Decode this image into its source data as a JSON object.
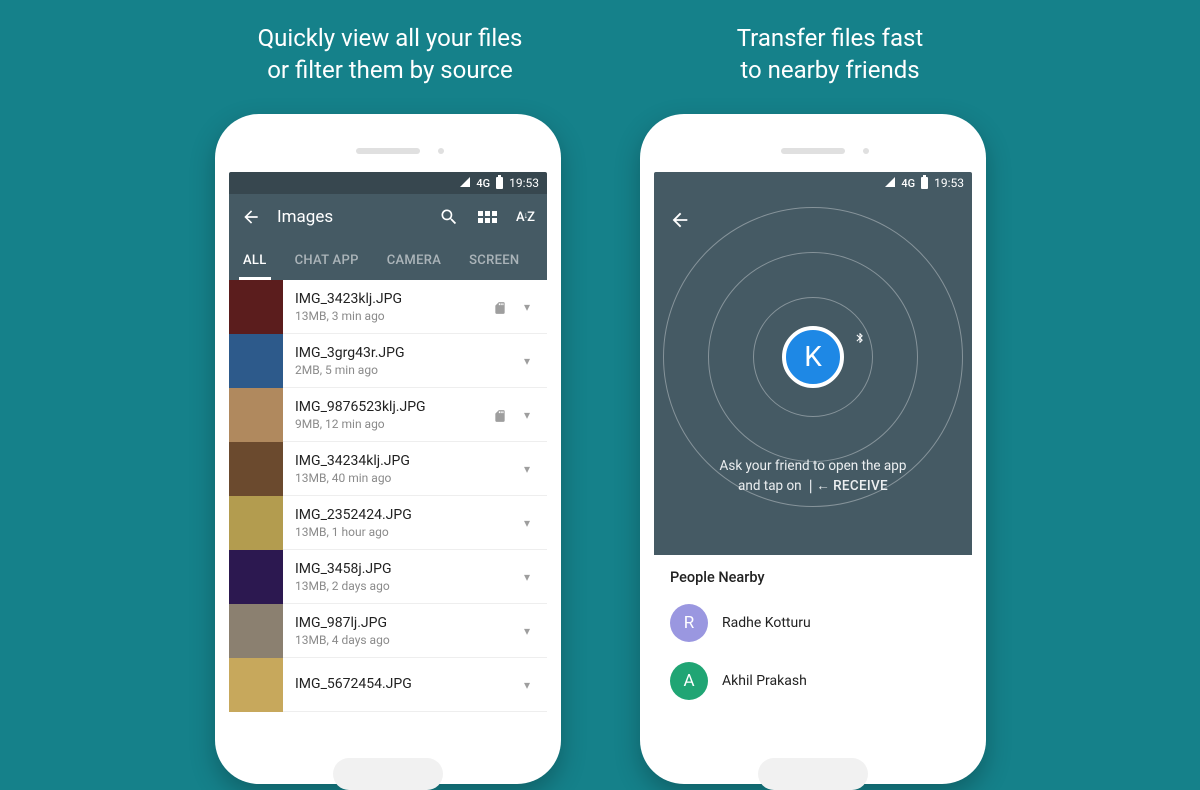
{
  "captions": {
    "left_line1": "Quickly view all your files",
    "left_line2": "or filter them by source",
    "right_line1": "Transfer files fast",
    "right_line2": "to nearby friends"
  },
  "status": {
    "network": "4G",
    "time": "19:53"
  },
  "left": {
    "title": "Images",
    "tabs": [
      "ALL",
      "CHAT APP",
      "CAMERA",
      "SCREEN"
    ],
    "files": [
      {
        "name": "IMG_3423klj.JPG",
        "sub": "13MB, 3 min ago",
        "sd": true,
        "thumb": "#5b1d1d"
      },
      {
        "name": "IMG_3grg43r.JPG",
        "sub": "2MB, 5 min ago",
        "sd": false,
        "thumb": "#2d5a8b"
      },
      {
        "name": "IMG_9876523klj.JPG",
        "sub": "9MB, 12 min ago",
        "sd": true,
        "thumb": "#b0895e"
      },
      {
        "name": "IMG_34234klj.JPG",
        "sub": "13MB, 40 min ago",
        "sd": false,
        "thumb": "#6b4a2e"
      },
      {
        "name": "IMG_2352424.JPG",
        "sub": "13MB, 1 hour ago",
        "sd": false,
        "thumb": "#b39c4f"
      },
      {
        "name": "IMG_3458j.JPG",
        "sub": "13MB, 2 days ago",
        "sd": false,
        "thumb": "#2c1850"
      },
      {
        "name": "IMG_987lj.JPG",
        "sub": "13MB, 4 days ago",
        "sd": false,
        "thumb": "#8b8070"
      },
      {
        "name": "IMG_5672454.JPG",
        "sub": "",
        "sd": false,
        "thumb": "#c7a85c"
      }
    ]
  },
  "right": {
    "avatar_letter": "K",
    "hint_line1": "Ask your friend to open the app",
    "hint_line2_prefix": "and tap on ",
    "hint_receive": "RECEIVE",
    "people_title": "People Nearby",
    "people": [
      {
        "letter": "R",
        "name": "Radhe Kotturu"
      },
      {
        "letter": "A",
        "name": "Akhil Prakash"
      }
    ]
  }
}
